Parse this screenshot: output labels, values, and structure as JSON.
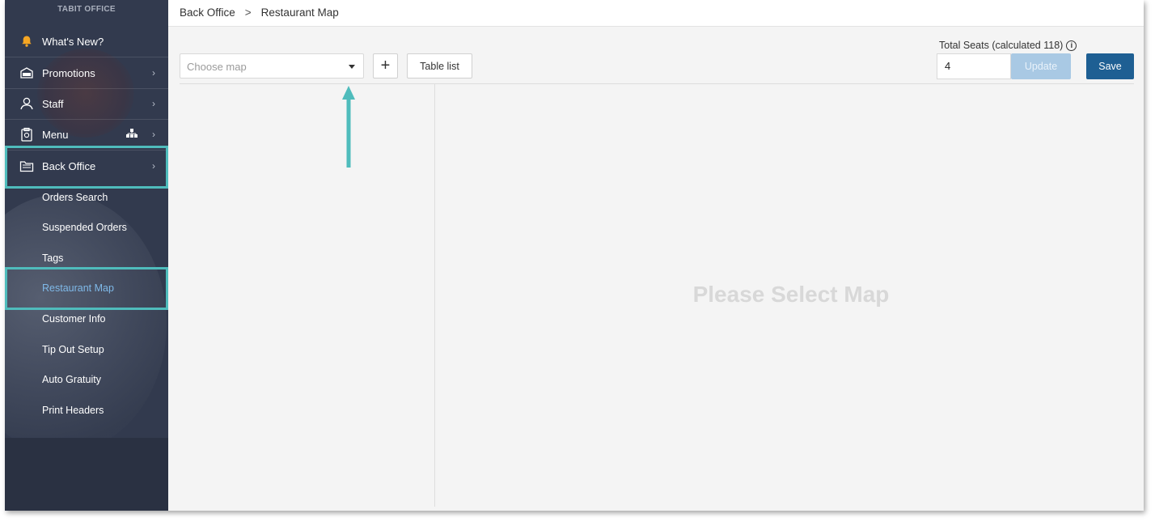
{
  "sidebar": {
    "brand": "TABIT OFFICE",
    "items": [
      {
        "label": "What's New?",
        "icon": "bell-icon"
      },
      {
        "label": "Promotions",
        "icon": "sale-tag-icon"
      },
      {
        "label": "Staff",
        "icon": "person-icon"
      },
      {
        "label": "Menu",
        "icon": "menu-clipboard-icon"
      },
      {
        "label": "Back Office",
        "icon": "folder-icon"
      }
    ],
    "sub_items": [
      {
        "label": "Orders Search"
      },
      {
        "label": "Suspended Orders"
      },
      {
        "label": "Tags"
      },
      {
        "label": "Restaurant Map",
        "active": true
      },
      {
        "label": "Customer Info"
      },
      {
        "label": "Tip Out Setup"
      },
      {
        "label": "Auto Gratuity"
      },
      {
        "label": "Print Headers"
      }
    ]
  },
  "breadcrumb": {
    "root": "Back Office",
    "separator": ">",
    "current": "Restaurant Map"
  },
  "toolbar": {
    "map_select_placeholder": "Choose map",
    "add_label": "+",
    "table_list_label": "Table list"
  },
  "seats": {
    "label": "Total Seats (calculated 118)",
    "info_glyph": "i",
    "value": "4",
    "update_label": "Update",
    "save_label": "Save"
  },
  "main": {
    "placeholder": "Please Select Map"
  },
  "colors": {
    "accent_highlight": "#4fbcbc",
    "save_button": "#1e5f93",
    "active_link": "#7fb9e8"
  }
}
